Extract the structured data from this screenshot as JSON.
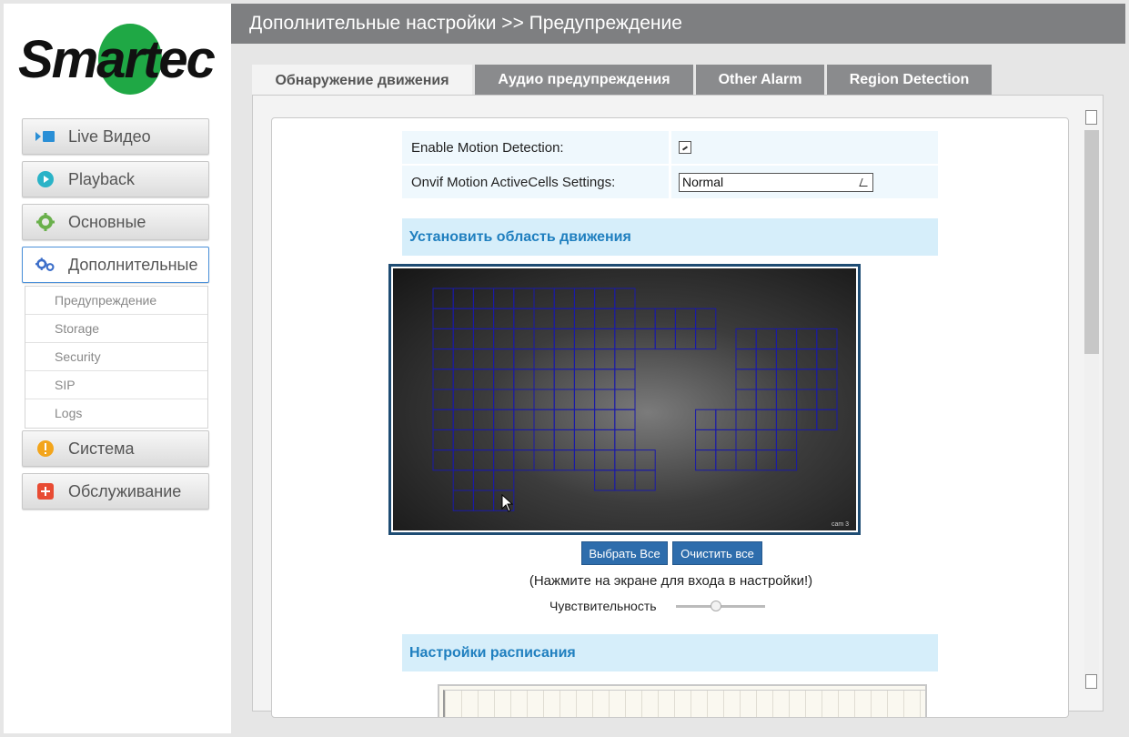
{
  "logo": {
    "text": "Smartec"
  },
  "sidebar": {
    "items": [
      {
        "label": "Live Видео",
        "icon": "video-icon",
        "color": "#2a8fd6"
      },
      {
        "label": "Playback",
        "icon": "play-circle-icon",
        "color": "#2ab3c7"
      },
      {
        "label": "Основные",
        "icon": "gear-icon",
        "color": "#6ab04c"
      },
      {
        "label": "Дополнительные",
        "icon": "gears-icon",
        "color": "#3c6ec9",
        "active": true
      },
      {
        "label": "Система",
        "icon": "warning-icon",
        "color": "#f3a51b"
      },
      {
        "label": "Обслуживание",
        "icon": "plus-box-icon",
        "color": "#e84b33"
      }
    ],
    "submenu": [
      "Предупреждение",
      "Storage",
      "Security",
      "SIP",
      "Logs"
    ]
  },
  "header": {
    "title": "Дополнительные настройки >> Предупреждение"
  },
  "tabs": [
    {
      "label": "Обнаружение движения",
      "active": true
    },
    {
      "label": "Аудио предупреждения"
    },
    {
      "label": "Other Alarm"
    },
    {
      "label": "Region Detection"
    }
  ],
  "motion": {
    "enable_label": "Enable Motion Detection:",
    "enable_checked": true,
    "onvif_label": "Onvif Motion ActiveCells Settings:",
    "onvif_value": "Normal",
    "area_title": "Установить область движения",
    "camera_label": "cam 3",
    "select_all": "Выбрать Все",
    "clear_all": "Очистить все",
    "hint": "(Нажмите на экране для входа в настройки!)",
    "sensitivity_label": "Чувствительность",
    "sensitivity_level": 0.45,
    "schedule_title": "Настройки расписания"
  },
  "colors": {
    "header_bg": "#7e7f81",
    "tab_bg": "#8a8b8d",
    "section_text": "#1f7fbf",
    "button_bg": "#2e6dac",
    "grid_line": "#1a1aa8"
  }
}
